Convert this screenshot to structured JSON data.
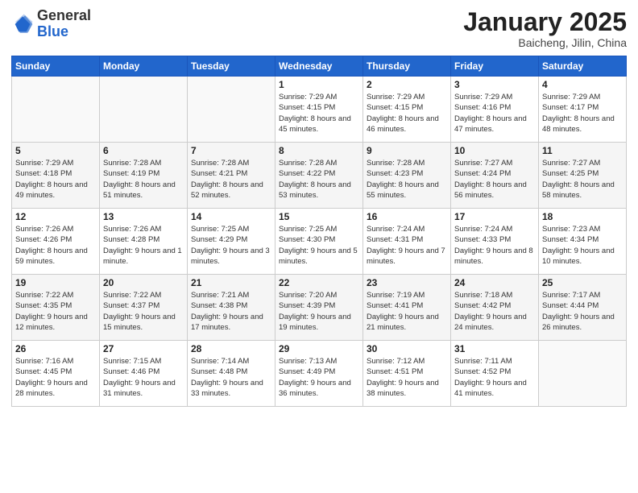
{
  "header": {
    "logo": {
      "general": "General",
      "blue": "Blue"
    },
    "title": "January 2025",
    "subtitle": "Baicheng, Jilin, China"
  },
  "weekdays": [
    "Sunday",
    "Monday",
    "Tuesday",
    "Wednesday",
    "Thursday",
    "Friday",
    "Saturday"
  ],
  "weeks": [
    [
      {
        "day": "",
        "sunrise": "",
        "sunset": "",
        "daylight": ""
      },
      {
        "day": "",
        "sunrise": "",
        "sunset": "",
        "daylight": ""
      },
      {
        "day": "",
        "sunrise": "",
        "sunset": "",
        "daylight": ""
      },
      {
        "day": "1",
        "sunrise": "Sunrise: 7:29 AM",
        "sunset": "Sunset: 4:15 PM",
        "daylight": "Daylight: 8 hours and 45 minutes."
      },
      {
        "day": "2",
        "sunrise": "Sunrise: 7:29 AM",
        "sunset": "Sunset: 4:15 PM",
        "daylight": "Daylight: 8 hours and 46 minutes."
      },
      {
        "day": "3",
        "sunrise": "Sunrise: 7:29 AM",
        "sunset": "Sunset: 4:16 PM",
        "daylight": "Daylight: 8 hours and 47 minutes."
      },
      {
        "day": "4",
        "sunrise": "Sunrise: 7:29 AM",
        "sunset": "Sunset: 4:17 PM",
        "daylight": "Daylight: 8 hours and 48 minutes."
      }
    ],
    [
      {
        "day": "5",
        "sunrise": "Sunrise: 7:29 AM",
        "sunset": "Sunset: 4:18 PM",
        "daylight": "Daylight: 8 hours and 49 minutes."
      },
      {
        "day": "6",
        "sunrise": "Sunrise: 7:28 AM",
        "sunset": "Sunset: 4:19 PM",
        "daylight": "Daylight: 8 hours and 51 minutes."
      },
      {
        "day": "7",
        "sunrise": "Sunrise: 7:28 AM",
        "sunset": "Sunset: 4:21 PM",
        "daylight": "Daylight: 8 hours and 52 minutes."
      },
      {
        "day": "8",
        "sunrise": "Sunrise: 7:28 AM",
        "sunset": "Sunset: 4:22 PM",
        "daylight": "Daylight: 8 hours and 53 minutes."
      },
      {
        "day": "9",
        "sunrise": "Sunrise: 7:28 AM",
        "sunset": "Sunset: 4:23 PM",
        "daylight": "Daylight: 8 hours and 55 minutes."
      },
      {
        "day": "10",
        "sunrise": "Sunrise: 7:27 AM",
        "sunset": "Sunset: 4:24 PM",
        "daylight": "Daylight: 8 hours and 56 minutes."
      },
      {
        "day": "11",
        "sunrise": "Sunrise: 7:27 AM",
        "sunset": "Sunset: 4:25 PM",
        "daylight": "Daylight: 8 hours and 58 minutes."
      }
    ],
    [
      {
        "day": "12",
        "sunrise": "Sunrise: 7:26 AM",
        "sunset": "Sunset: 4:26 PM",
        "daylight": "Daylight: 8 hours and 59 minutes."
      },
      {
        "day": "13",
        "sunrise": "Sunrise: 7:26 AM",
        "sunset": "Sunset: 4:28 PM",
        "daylight": "Daylight: 9 hours and 1 minute."
      },
      {
        "day": "14",
        "sunrise": "Sunrise: 7:25 AM",
        "sunset": "Sunset: 4:29 PM",
        "daylight": "Daylight: 9 hours and 3 minutes."
      },
      {
        "day": "15",
        "sunrise": "Sunrise: 7:25 AM",
        "sunset": "Sunset: 4:30 PM",
        "daylight": "Daylight: 9 hours and 5 minutes."
      },
      {
        "day": "16",
        "sunrise": "Sunrise: 7:24 AM",
        "sunset": "Sunset: 4:31 PM",
        "daylight": "Daylight: 9 hours and 7 minutes."
      },
      {
        "day": "17",
        "sunrise": "Sunrise: 7:24 AM",
        "sunset": "Sunset: 4:33 PM",
        "daylight": "Daylight: 9 hours and 8 minutes."
      },
      {
        "day": "18",
        "sunrise": "Sunrise: 7:23 AM",
        "sunset": "Sunset: 4:34 PM",
        "daylight": "Daylight: 9 hours and 10 minutes."
      }
    ],
    [
      {
        "day": "19",
        "sunrise": "Sunrise: 7:22 AM",
        "sunset": "Sunset: 4:35 PM",
        "daylight": "Daylight: 9 hours and 12 minutes."
      },
      {
        "day": "20",
        "sunrise": "Sunrise: 7:22 AM",
        "sunset": "Sunset: 4:37 PM",
        "daylight": "Daylight: 9 hours and 15 minutes."
      },
      {
        "day": "21",
        "sunrise": "Sunrise: 7:21 AM",
        "sunset": "Sunset: 4:38 PM",
        "daylight": "Daylight: 9 hours and 17 minutes."
      },
      {
        "day": "22",
        "sunrise": "Sunrise: 7:20 AM",
        "sunset": "Sunset: 4:39 PM",
        "daylight": "Daylight: 9 hours and 19 minutes."
      },
      {
        "day": "23",
        "sunrise": "Sunrise: 7:19 AM",
        "sunset": "Sunset: 4:41 PM",
        "daylight": "Daylight: 9 hours and 21 minutes."
      },
      {
        "day": "24",
        "sunrise": "Sunrise: 7:18 AM",
        "sunset": "Sunset: 4:42 PM",
        "daylight": "Daylight: 9 hours and 24 minutes."
      },
      {
        "day": "25",
        "sunrise": "Sunrise: 7:17 AM",
        "sunset": "Sunset: 4:44 PM",
        "daylight": "Daylight: 9 hours and 26 minutes."
      }
    ],
    [
      {
        "day": "26",
        "sunrise": "Sunrise: 7:16 AM",
        "sunset": "Sunset: 4:45 PM",
        "daylight": "Daylight: 9 hours and 28 minutes."
      },
      {
        "day": "27",
        "sunrise": "Sunrise: 7:15 AM",
        "sunset": "Sunset: 4:46 PM",
        "daylight": "Daylight: 9 hours and 31 minutes."
      },
      {
        "day": "28",
        "sunrise": "Sunrise: 7:14 AM",
        "sunset": "Sunset: 4:48 PM",
        "daylight": "Daylight: 9 hours and 33 minutes."
      },
      {
        "day": "29",
        "sunrise": "Sunrise: 7:13 AM",
        "sunset": "Sunset: 4:49 PM",
        "daylight": "Daylight: 9 hours and 36 minutes."
      },
      {
        "day": "30",
        "sunrise": "Sunrise: 7:12 AM",
        "sunset": "Sunset: 4:51 PM",
        "daylight": "Daylight: 9 hours and 38 minutes."
      },
      {
        "day": "31",
        "sunrise": "Sunrise: 7:11 AM",
        "sunset": "Sunset: 4:52 PM",
        "daylight": "Daylight: 9 hours and 41 minutes."
      },
      {
        "day": "",
        "sunrise": "",
        "sunset": "",
        "daylight": ""
      }
    ]
  ]
}
